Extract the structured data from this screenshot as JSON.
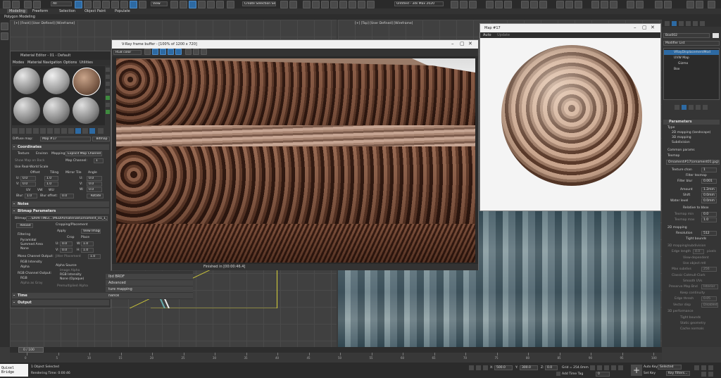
{
  "menubar": {
    "tabs": [
      "Modeling",
      "Freeform",
      "Selection",
      "Object Paint",
      "Populate"
    ],
    "subtab": "Polygon Modeling",
    "workspace": "Untitled - 3ds Max 2020",
    "selection_set": "Create Selection Se",
    "view_dropdown": "View"
  },
  "viewport_labels": {
    "left": "[+] [Front] [User Defined] [Wireframe]",
    "right": "[+] [Top] [User Defined] [Wireframe]"
  },
  "material_editor": {
    "title": "Material Editor - 01 - Default",
    "menu": [
      "Modes",
      "Material",
      "Navigation",
      "Options",
      "Utilities"
    ],
    "map_label": "Diffuse map:",
    "map_name": "Map #17",
    "map_type": "Bitmap",
    "sections": {
      "coordinates": "Coordinates",
      "noise": "Noise",
      "bitmap_params": "Bitmap Parameters",
      "time": "Time",
      "output": "Output"
    },
    "coords": {
      "texture": "Texture",
      "environ": "Environ",
      "mapping_label": "Mapping:",
      "mapping": "Explicit Map Channel",
      "map_channel_label": "Map Channel:",
      "map_channel": "1",
      "show_map_back": "Show Map on Back",
      "use_real_world": "Use Real-World Scale",
      "offset": "Offset",
      "tiling": "Tiling",
      "mirror_tile": "Mirror Tile",
      "angle": "Angle",
      "u": "U:",
      "v": "V:",
      "w": "W:",
      "u_offset": "0.0",
      "v_offset": "0.0",
      "u_tiling": "1.0",
      "v_tiling": "1.0",
      "u_angle": "0.0",
      "v_angle": "0.0",
      "w_angle": "0.0",
      "uv": "UV",
      "vw": "VW",
      "wu": "WU",
      "blur_label": "Blur:",
      "blur": "1.0",
      "blur_offset_label": "Blur offset:",
      "blur_offset": "0.0",
      "rotate": "Rotate"
    },
    "bitmap": {
      "bitmap_label": "Bitmap:",
      "path": "...\\DRAFTING\\...\\MEDIA\\materials\\ornament_01_1_1.jpg",
      "reload": "Reload",
      "cropping": "Cropping/Placement",
      "apply": "Apply",
      "view_image": "View Image",
      "crop": "Crop",
      "place": "Place",
      "u_lbl": "U:",
      "v_lbl": "V:",
      "w_lbl": "W:",
      "h_lbl": "H:",
      "u_val": "0.0",
      "v_val": "0.0",
      "w_val": "1.0",
      "h_val": "1.0",
      "jitter": "Jitter Placement",
      "jitter_val": "1.0",
      "filtering": "Filtering",
      "pyramidal": "Pyramidal",
      "summed": "Summed Area",
      "none": "None",
      "mono_out": "Mono Channel Output:",
      "rgb_intensity": "RGB Intensity",
      "alpha": "Alpha",
      "rgb_out": "RGB Channel Output:",
      "rgb": "RGB",
      "alpha_as_gray": "Alpha as Gray",
      "alpha_source": "Alpha Source",
      "image_alpha": "Image Alpha",
      "rgb_int2": "RGB Intensity",
      "none_opaque": "None (Opaque)",
      "premult": "Premultiplied Alpha"
    }
  },
  "frame_buffer": {
    "title": "V-Ray frame buffer - [100% of 1200 x 720]",
    "channel": "RGB color",
    "status": "Finished in [00:00:46.4]"
  },
  "map_window": {
    "title": "Map #17",
    "auto": "Auto",
    "update": "Update"
  },
  "partial_rollouts": [
    "lbd BRDF",
    "Advanced",
    "ture mapping",
    "nance"
  ],
  "right_panel": {
    "object_name": "Box002",
    "modifier_list": "Modifier List",
    "stack": [
      "VRayDisplacementMod",
      "UVW Map",
      "Gizmo",
      "Box"
    ],
    "parameters": "Parameters",
    "type": "Type",
    "type_2d": "2D mapping (landscape)",
    "type_3d": "3D mapping",
    "type_sub": "Subdivision",
    "common": "Common params",
    "texmap": "Texmap",
    "texmap_val": "Ornament#17(ornament01.jpg)",
    "texmap_chan": "Texture chan",
    "texmap_chan_val": "1",
    "filter_texmap": "Filter texmap",
    "filter_blur": "Filter blur",
    "filter_blur_val": "0.001",
    "amount": "Amount",
    "amount_val": "1.2mm",
    "shift": "Shift",
    "shift_val": "0.0mm",
    "water": "Water level",
    "water_val": "0.0mm",
    "relative_bbox": "Relative to bbox",
    "texmap_min": "Texmap min",
    "texmap_min_val": "0.0",
    "texmap_max": "Texmap max",
    "texmap_max_val": "1.0",
    "mapping_2d": "2D mapping",
    "resolution": "Resolution",
    "resolution_val": "512",
    "tight_bounds": "Tight bounds",
    "subdiv": "3D mapping/subdivision",
    "edge_length": "Edge length",
    "edge_val": "4.0",
    "pixels": "pixels",
    "view_dep": "View-dependent",
    "use_obj_mtl": "Use object mtl",
    "max_subdivs": "Max subdivs",
    "max_subdivs_val": "256",
    "classic": "Classic Catmull-Clark",
    "smooth_uv": "Smooth UVs",
    "preserve": "Preserve Map Bnd",
    "preserve_val": "Interior",
    "keep_continuity": "Keep continuity",
    "edge_thresh": "Edge thresh",
    "edge_thresh_val": "0.05",
    "vector_disp": "Vector disp",
    "vector_disp_val": "Disabled",
    "3d_perf": "3D performance",
    "tight_bounds2": "Tight bounds",
    "static_geom": "Static geometry",
    "cache_normals": "Cache normals"
  },
  "timeline": {
    "frame": "0 / 100",
    "ticks": [
      "0",
      "5",
      "10",
      "15",
      "20",
      "25",
      "30",
      "35",
      "40",
      "45",
      "50",
      "55",
      "60",
      "65",
      "70",
      "75",
      "80",
      "85",
      "90",
      "95",
      "100"
    ]
  },
  "statusbar": {
    "script": "Quixel Bridge",
    "selected": "1 Object Selected",
    "render_time": "Rendering Time: 0:00:46",
    "x_lbl": "X:",
    "x_val": "500.0",
    "y_lbl": "Y:",
    "y_val": "300.0",
    "z_lbl": "Z:",
    "z_val": "0.0",
    "grid": "Grid = 254.0mm",
    "add_time_tag": "Add Time Tag",
    "auto_key": "Auto Key",
    "set_key": "Set Key",
    "selected_dd": "Selected",
    "key_filters": "Key Filters...",
    "frame": "0"
  },
  "colors": {
    "accent": "#2d6aa3",
    "bg": "#3a3a3a",
    "panel": "#2e2e2e"
  }
}
